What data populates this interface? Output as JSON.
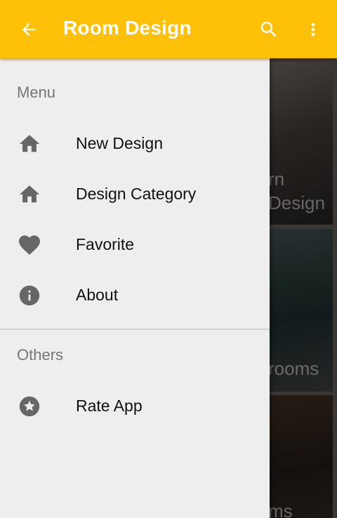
{
  "appbar": {
    "title": "Room Design",
    "back_icon": "arrow-back-icon",
    "search_icon": "search-icon",
    "more_icon": "more-vert-icon",
    "color": "#FFC107"
  },
  "background_cards": [
    {
      "caption_lines": [
        "rn",
        "Design"
      ]
    },
    {
      "caption_lines": [
        "rooms"
      ]
    },
    {
      "caption_lines": [
        "ms"
      ]
    }
  ],
  "drawer": {
    "menu_section": "Menu",
    "items": [
      {
        "label": "New Design",
        "icon": "home-icon"
      },
      {
        "label": "Design Category",
        "icon": "home-icon"
      },
      {
        "label": "Favorite",
        "icon": "heart-icon"
      },
      {
        "label": "About",
        "icon": "info-icon"
      }
    ],
    "others_section": "Others",
    "others_items": [
      {
        "label": "Rate App",
        "icon": "star-circle-icon"
      }
    ]
  }
}
